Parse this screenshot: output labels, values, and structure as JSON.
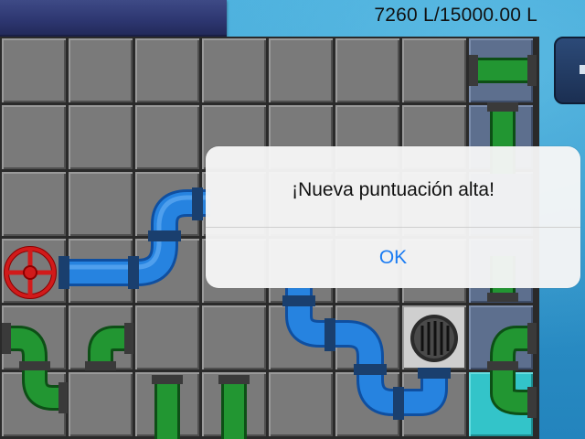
{
  "hud": {
    "volume": "7260 L/15000.00 L"
  },
  "dialog": {
    "message": "¡Nueva puntuación alta!",
    "ok_label": "OK"
  },
  "colors": {
    "blue_pipe": "#1f75d1",
    "green_pipe": "#1f8a2c",
    "valve": "#d11a1a",
    "drain_tile": "#cfcfcf",
    "target_tile": "#33c4c9"
  }
}
